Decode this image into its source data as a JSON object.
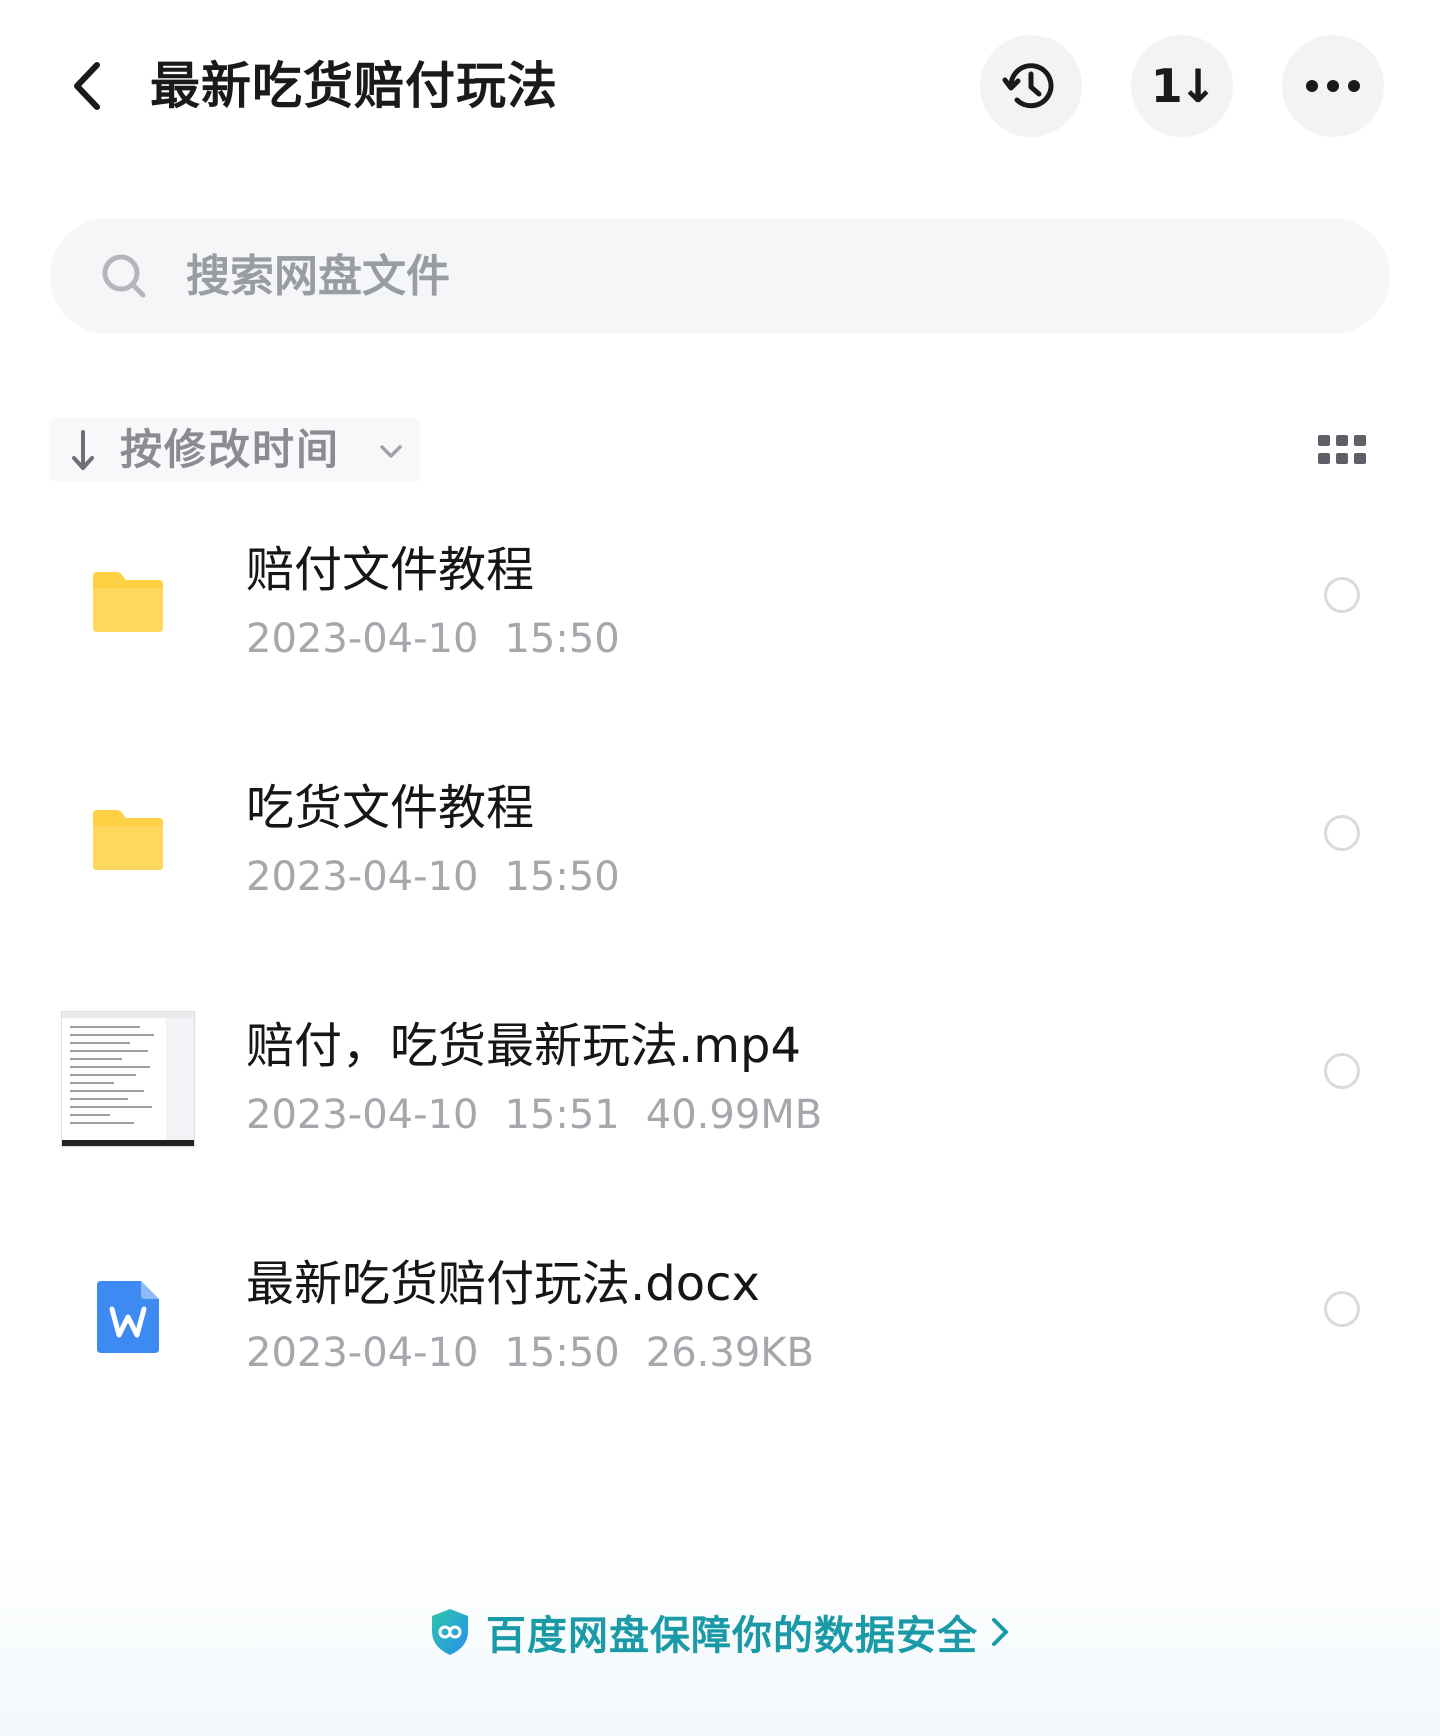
{
  "header": {
    "title": "最新吃货赔付玩法",
    "sort_button_glyph": "1↓"
  },
  "search": {
    "placeholder": "搜索网盘文件"
  },
  "sort_bar": {
    "label": "按修改时间"
  },
  "files": [
    {
      "name": "赔付文件教程",
      "date": "2023-04-10",
      "time": "15:50",
      "size": "",
      "type": "folder-icon"
    },
    {
      "name": "吃货文件教程",
      "date": "2023-04-10",
      "time": "15:50",
      "size": "",
      "type": "folder-icon"
    },
    {
      "name": "赔付，吃货最新玩法.mp4",
      "date": "2023-04-10",
      "time": "15:51",
      "size": "40.99MB",
      "type": "video-thumbnail"
    },
    {
      "name": "最新吃货赔付玩法.docx",
      "date": "2023-04-10",
      "time": "15:50",
      "size": "26.39KB",
      "type": "word-doc-icon"
    }
  ],
  "footer": {
    "security_text": "百度网盘保障你的数据安全"
  },
  "colors": {
    "folder": "#fdd143",
    "word": "#3d8bf2",
    "link": "#1a9aa6",
    "meta_text": "#a5a7ad",
    "button_bg": "#f2f3f5"
  }
}
